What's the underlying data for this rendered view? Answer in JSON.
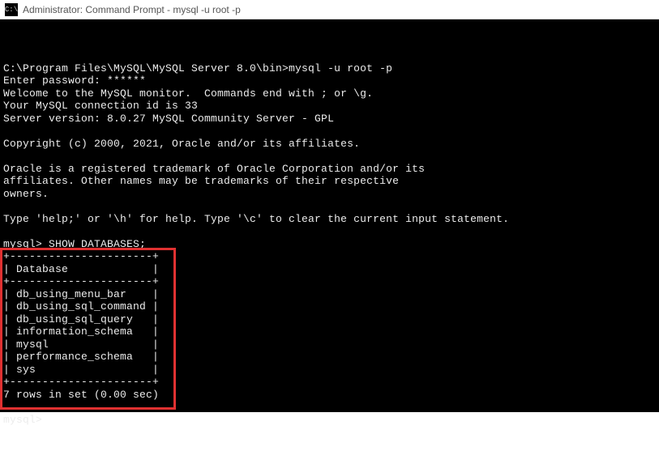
{
  "title_bar": {
    "icon_label": "C:\\",
    "text": "Administrator: Command Prompt - mysql  -u root -p"
  },
  "terminal": {
    "lines": [
      "",
      "C:\\Program Files\\MySQL\\MySQL Server 8.0\\bin>mysql -u root -p",
      "Enter password: ******",
      "Welcome to the MySQL monitor.  Commands end with ; or \\g.",
      "Your MySQL connection id is 33",
      "Server version: 8.0.27 MySQL Community Server - GPL",
      "",
      "Copyright (c) 2000, 2021, Oracle and/or its affiliates.",
      "",
      "Oracle is a registered trademark of Oracle Corporation and/or its",
      "affiliates. Other names may be trademarks of their respective",
      "owners.",
      "",
      "Type 'help;' or '\\h' for help. Type '\\c' to clear the current input statement.",
      "",
      "mysql> SHOW DATABASES;",
      "+----------------------+",
      "| Database             |",
      "+----------------------+",
      "| db_using_menu_bar    |",
      "| db_using_sql_command |",
      "| db_using_sql_query   |",
      "| information_schema   |",
      "| mysql                |",
      "| performance_schema   |",
      "| sys                  |",
      "+----------------------+",
      "7 rows in set (0.00 sec)",
      "",
      "mysql>"
    ]
  },
  "chart_data": {
    "type": "table",
    "title": "SHOW DATABASES",
    "columns": [
      "Database"
    ],
    "rows": [
      [
        "db_using_menu_bar"
      ],
      [
        "db_using_sql_command"
      ],
      [
        "db_using_sql_query"
      ],
      [
        "information_schema"
      ],
      [
        "mysql"
      ],
      [
        "performance_schema"
      ],
      [
        "sys"
      ]
    ],
    "footer": "7 rows in set (0.00 sec)"
  }
}
